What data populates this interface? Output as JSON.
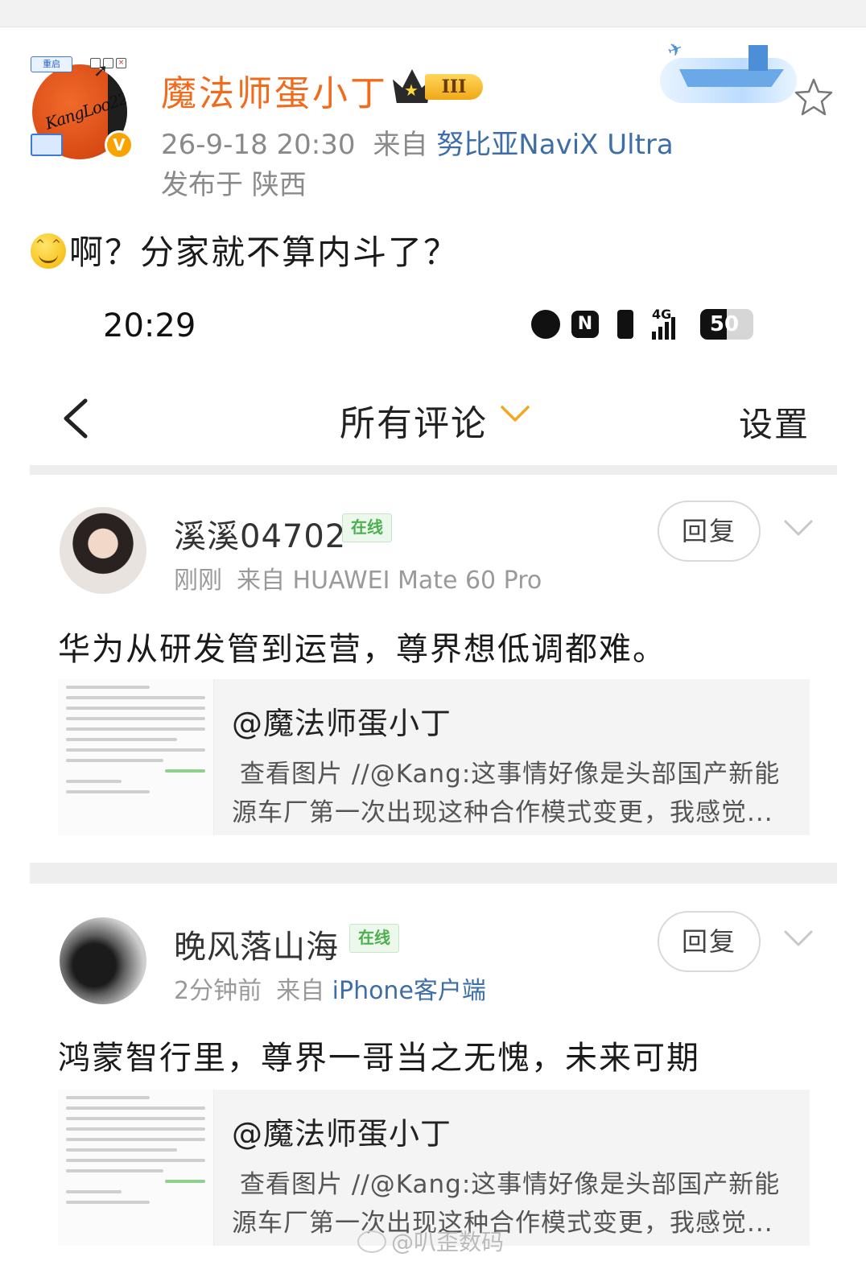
{
  "post": {
    "author": "魔法师蛋小丁",
    "rank_badge": "III",
    "timestamp": "26-9-18 20:30",
    "source_prefix": "来自",
    "device": "努比亚NaviX Ultra",
    "location": "发布于 陕西",
    "text": "啊？分家就不算内斗了？",
    "avatar_restart_chip": "重启",
    "avatar_scribble": "KangLoo222",
    "verified_mark": "V"
  },
  "embedded": {
    "status_bar": {
      "time": "20:29",
      "battery": "50",
      "network": "4G"
    },
    "nav": {
      "title": "所有评论",
      "settings": "设置"
    }
  },
  "comments": [
    {
      "username": "溪溪04702",
      "online": "在线",
      "time": "刚刚",
      "source_prefix": "来自",
      "device": "HUAWEI Mate 60 Pro",
      "text": "华为从研发管到运营，尊界想低调都难。",
      "reply_label": "回复",
      "quote": {
        "author": "@魔法师蛋小丁",
        "line1": "查看图片 //@Kang:这事情好像是头部国产新能",
        "line2": "源车厂第一次出现这种合作模式变更，我感觉..."
      }
    },
    {
      "username": "晚风落山海",
      "online": "在线",
      "time": "2分钟前",
      "source_prefix": "来自",
      "device": "iPhone客户端",
      "text": "鸿蒙智行里，尊界一哥当之无愧，未来可期",
      "reply_label": "回复",
      "quote": {
        "author": "@魔法师蛋小丁",
        "line1": "查看图片 //@Kang:这事情好像是头部国产新能",
        "line2": "源车厂第一次出现这种合作模式变更，我感觉..."
      }
    }
  ],
  "watermark": "@叭歪数码",
  "colors": {
    "author_orange": "#f26b1d",
    "link_blue": "#3d6ea8",
    "online_green": "#4caf50",
    "meta_gray": "#8a8a8a"
  },
  "icons": [
    "star-icon",
    "back-chevron-icon",
    "chevron-down-icon",
    "alarm-icon",
    "nfc-icon",
    "vibrate-icon",
    "signal-icon",
    "battery-icon",
    "crown-icon",
    "verified-icon",
    "smile-emoji-icon"
  ]
}
